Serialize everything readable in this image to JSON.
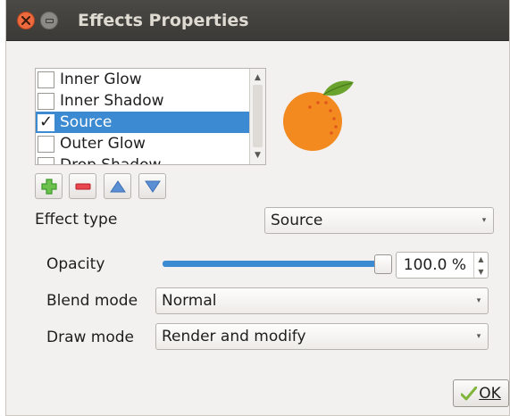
{
  "window": {
    "title": "Effects Properties"
  },
  "effects_list": {
    "items": [
      {
        "label": "Inner Glow",
        "checked": false,
        "selected": false
      },
      {
        "label": "Inner Shadow",
        "checked": false,
        "selected": false
      },
      {
        "label": "Source",
        "checked": true,
        "selected": true
      },
      {
        "label": "Outer Glow",
        "checked": false,
        "selected": false
      },
      {
        "label": "Drop Shadow",
        "checked": false,
        "selected": false
      }
    ]
  },
  "preview": {
    "icon": "orange-fruit-icon"
  },
  "toolbar": {
    "add_icon": "plus-icon",
    "remove_icon": "minus-icon",
    "up_icon": "arrow-up-icon",
    "down_icon": "arrow-down-icon"
  },
  "form": {
    "effect_type_label": "Effect type",
    "effect_type_value": "Source",
    "opacity_label": "Opacity",
    "opacity_value": "100.0 %",
    "opacity_level": 1.0,
    "blend_mode_label": "Blend mode",
    "blend_mode_value": "Normal",
    "draw_mode_label": "Draw mode",
    "draw_mode_value": "Render and modify"
  },
  "buttons": {
    "ok_label": "OK"
  },
  "colors": {
    "selection": "#3c8ad1",
    "titlebar": "#3b3a36",
    "close_button": "#ec6a3d",
    "orange": "#f28a1f",
    "leaf": "#6aa32d",
    "add_green": "#3f9a2e",
    "remove_red": "#d62a36",
    "arrow_blue": "#3d6fb4"
  }
}
